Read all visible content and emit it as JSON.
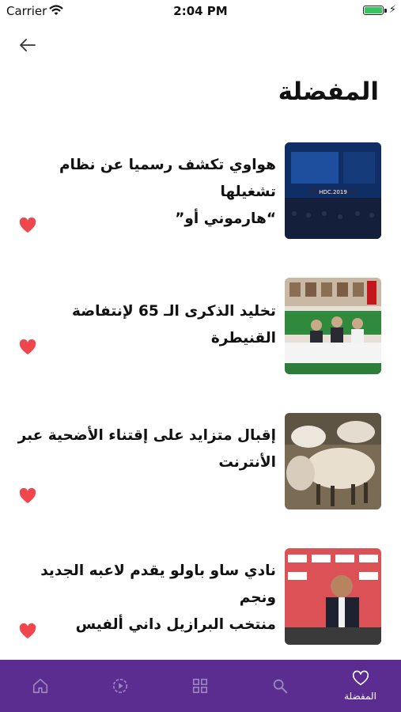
{
  "status_bar": {
    "carrier": "Carrier",
    "time": "2:04 PM"
  },
  "header": {
    "title": "المفضلة"
  },
  "articles": [
    {
      "headline_line1": "هواوي تكشف رسميا عن نظام تشغيلها",
      "headline_line2": "“هارموني أو”",
      "thumb_text": "HDC.2019"
    },
    {
      "headline_line1": "تخليد الذكرى الـ 65 لإنتفاضة القنيطرة",
      "headline_line2": ""
    },
    {
      "headline_line1": "إقبال متزايد على إقتناء الأضحية عبر",
      "headline_line2": "الأنترنت"
    },
    {
      "headline_line1": "نادي ساو باولو يقدم لاعبه الجديد ونجم",
      "headline_line2": "منتخب البرازيل داني ألفيس"
    }
  ],
  "tab_bar": {
    "tabs": [
      {
        "icon": "home-icon",
        "label": ""
      },
      {
        "icon": "play-icon",
        "label": ""
      },
      {
        "icon": "grid-icon",
        "label": ""
      },
      {
        "icon": "search-icon",
        "label": ""
      },
      {
        "icon": "heart-outline-icon",
        "label": "المفضلة"
      }
    ]
  },
  "colors": {
    "accent": "#5b2d91",
    "heart": "#f0474f",
    "inactive_icon": "#9b86bf"
  }
}
